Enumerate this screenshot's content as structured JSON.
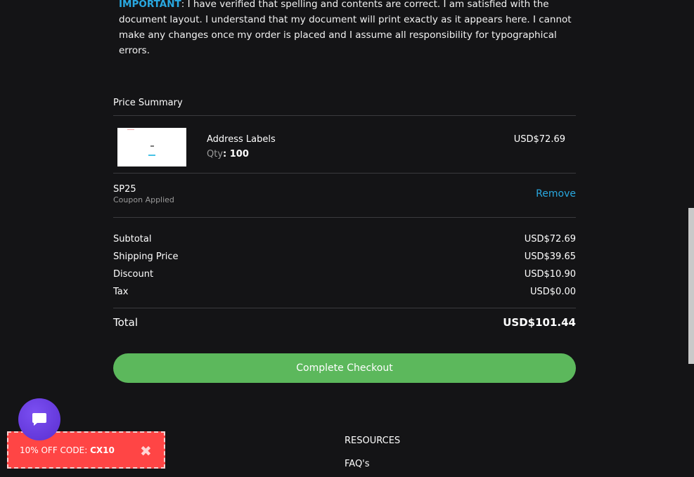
{
  "notice": {
    "keyword": "IMPORTANT",
    "text": ": I have verified that spelling and contents are correct. I am satisfied with the document layout. I understand that my document will print exactly as it appears here. I cannot make any changes once my order is placed and I assume all responsibility for typographical errors."
  },
  "summary": {
    "title": "Price Summary",
    "item": {
      "name": "Address Labels",
      "qty_label": "Qty",
      "qty_value": ": 100",
      "price": "USD$72.69"
    },
    "coupon": {
      "code": "SP25",
      "note": "Coupon Applied",
      "remove_label": "Remove"
    },
    "rows": [
      {
        "label": "Subtotal",
        "value": "USD$72.69"
      },
      {
        "label": "Shipping Price",
        "value": "USD$39.65"
      },
      {
        "label": "Discount",
        "value": "USD$10.90"
      },
      {
        "label": "Tax",
        "value": "USD$0.00"
      }
    ],
    "total_label": "Total",
    "total_value": "USD$101.44",
    "checkout_label": "Complete Checkout"
  },
  "footer": {
    "resources_heading": "RESOURCES",
    "faq_link": "FAQ's"
  },
  "promo": {
    "prefix": "10% OFF CODE: ",
    "code": "CX10",
    "close_glyph": "✖"
  },
  "colors": {
    "background": "#141416",
    "accent": "#29a8e0",
    "checkout": "#5cb85c",
    "promo": "#ff4545",
    "chat": "#6a3ee6"
  }
}
